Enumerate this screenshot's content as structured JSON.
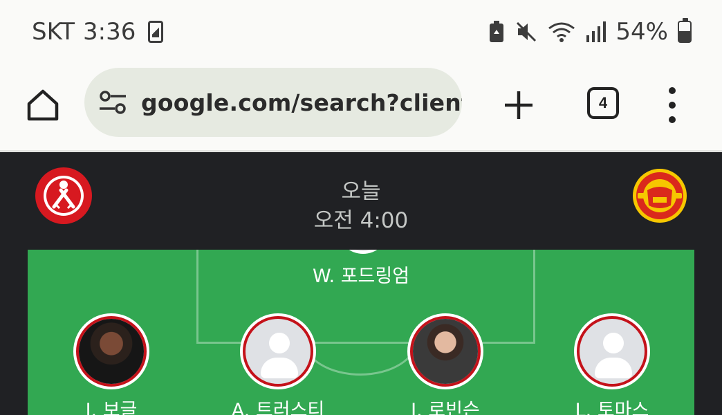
{
  "status_bar": {
    "carrier": "SKT",
    "time": "3:36",
    "battery_percent": "54%",
    "icons": [
      "sim-card-icon",
      "battery-saver-icon",
      "mute-icon",
      "wifi-icon",
      "signal-icon",
      "battery-icon"
    ]
  },
  "browser": {
    "url": "google.com/search?client=",
    "tab_count": "4",
    "icons": [
      "home-icon",
      "site-settings-icon",
      "new-tab-icon",
      "tab-switcher-icon",
      "more-menu-icon"
    ]
  },
  "match": {
    "day": "오늘",
    "time": "오전 4:00",
    "home_team_logo": "sheffield-united-crest",
    "away_team_logo": "manchester-united-crest"
  },
  "lineup": {
    "goalkeeper": "W. 포드링엄",
    "defenders": [
      "J. 보글",
      "A. 트러스티",
      "J. 로빈슨",
      "L. 토마스"
    ]
  },
  "colors": {
    "pitch": "#32a852",
    "header_bg": "#202124",
    "omnibox_bg": "#e6eae1",
    "player_ring": "#c4121a"
  }
}
